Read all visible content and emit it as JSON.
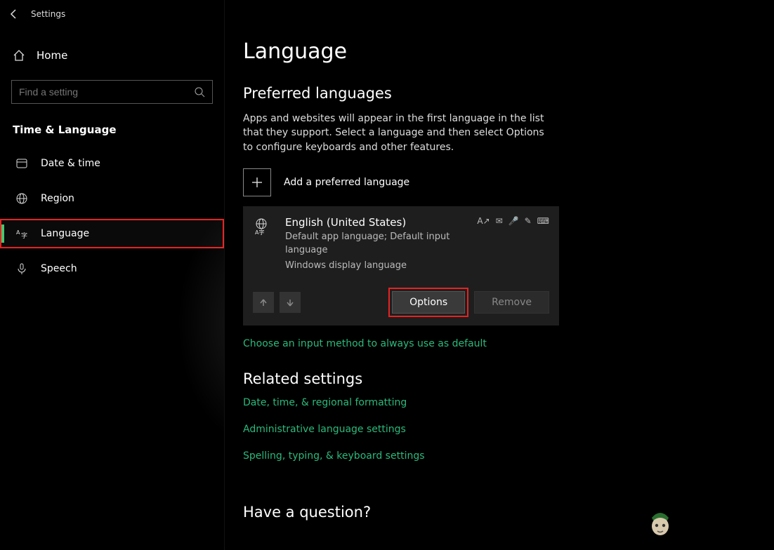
{
  "title": "Settings",
  "search": {
    "placeholder": "Find a setting"
  },
  "home_label": "Home",
  "category": "Time & Language",
  "nav": [
    {
      "label": "Date & time",
      "icon": "clock"
    },
    {
      "label": "Region",
      "icon": "globe"
    },
    {
      "label": "Language",
      "icon": "language",
      "active": true,
      "highlight": true
    },
    {
      "label": "Speech",
      "icon": "mic"
    }
  ],
  "page": {
    "heading": "Language",
    "preferred_title": "Preferred languages",
    "preferred_desc": "Apps and websites will appear in the first language in the list that they support. Select a language and then select Options to configure keyboards and other features.",
    "add_label": "Add a preferred language",
    "lang": {
      "name": "English (United States)",
      "sub1": "Default app language; Default input language",
      "sub2": "Windows display language"
    },
    "options_btn": "Options",
    "remove_btn": "Remove",
    "input_method_link": "Choose an input method to always use as default",
    "related_title": "Related settings",
    "links": [
      "Date, time, & regional formatting",
      "Administrative language settings",
      "Spelling, typing, & keyboard settings"
    ],
    "question_title": "Have a question?"
  }
}
